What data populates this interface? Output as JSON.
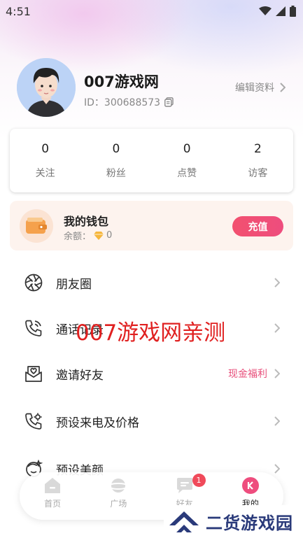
{
  "status_bar": {
    "time": "4:51"
  },
  "profile": {
    "nickname": "007游戏网",
    "id_text": "ID：300688573",
    "edit_label": "编辑资料"
  },
  "stats": [
    {
      "value": "0",
      "label": "关注"
    },
    {
      "value": "0",
      "label": "粉丝"
    },
    {
      "value": "0",
      "label": "点赞"
    },
    {
      "value": "2",
      "label": "访客"
    }
  ],
  "wallet": {
    "title": "我的钱包",
    "balance_label": "余额：",
    "balance_value": "0",
    "recharge_label": "充值"
  },
  "menu": [
    {
      "label": "朋友圈",
      "icon": "aperture-icon",
      "extra": ""
    },
    {
      "label": "通话记录",
      "icon": "phone-call-icon",
      "extra": ""
    },
    {
      "label": "邀请好友",
      "icon": "invite-mail-icon",
      "extra": "现金福利"
    },
    {
      "label": "预设来电及价格",
      "icon": "phone-settings-icon",
      "extra": ""
    },
    {
      "label": "预设美颜",
      "icon": "beauty-face-icon",
      "extra": ""
    }
  ],
  "watermark_text": "007游戏网亲测",
  "tabbar": [
    {
      "label": "首页",
      "icon": "home-icon"
    },
    {
      "label": "广场",
      "icon": "planet-icon"
    },
    {
      "label": "好友",
      "icon": "chat-bubble-icon",
      "badge": "1"
    },
    {
      "label": "我的",
      "icon": "profile-icon"
    }
  ],
  "site_logo_text": "二货游戏园",
  "colors": {
    "accent": "#EE4D7E",
    "badge": "#F04A5A",
    "wallet_bg": "#FDF3EE",
    "watermark": "#E02020"
  }
}
